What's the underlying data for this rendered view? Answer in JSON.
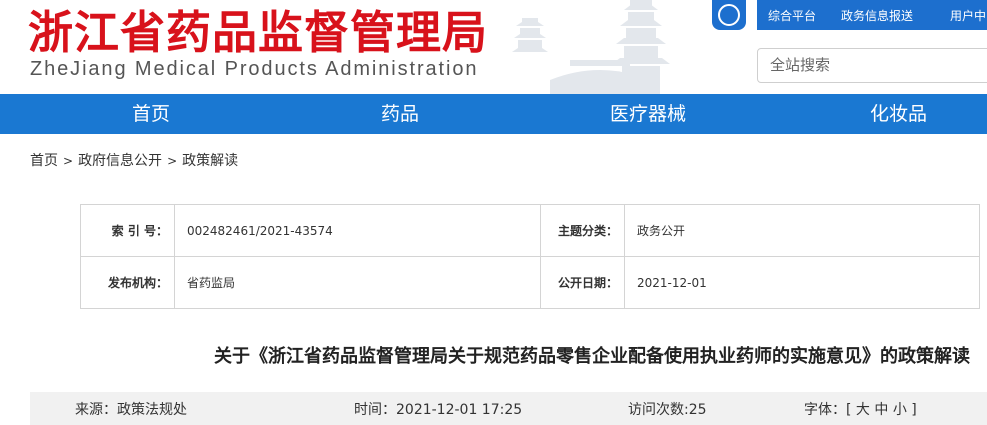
{
  "header": {
    "title_cn": "浙江省药品监督管理局",
    "title_en": "ZheJiang Medical Products Administration",
    "app_icon": "app-logo-icon",
    "links": [
      "综合平台",
      "政务信息报送",
      "用户中"
    ],
    "search_placeholder": "全站搜索"
  },
  "nav": {
    "items": [
      "首页",
      "药品",
      "医疗器械",
      "化妆品"
    ]
  },
  "breadcrumb": {
    "items": [
      "首页",
      "政府信息公开",
      "政策解读"
    ],
    "separator": ">"
  },
  "info": {
    "index_label": "索 引 号：",
    "index_value": "002482461/2021-43574",
    "topic_label": "主题分类：",
    "topic_value": "政务公开",
    "publisher_label": "发布机构：",
    "publisher_value": "省药监局",
    "date_label": "公开日期：",
    "date_value": "2021-12-01"
  },
  "article": {
    "title": "关于《浙江省药品监督管理局关于规范药品零售企业配备使用执业药师的实施意见》的政策解读"
  },
  "meta": {
    "source": "来源：政策法规处",
    "time": "时间：2021-12-01 17:25",
    "visits": "访问次数:25",
    "font_label": "字体：[",
    "font_large": "大",
    "font_medium": "中",
    "font_small": "小",
    "font_close": "]"
  },
  "colors": {
    "brand_red": "#d8121b",
    "nav_blue": "#1a78d2",
    "topbar_blue": "#1d6fce"
  }
}
